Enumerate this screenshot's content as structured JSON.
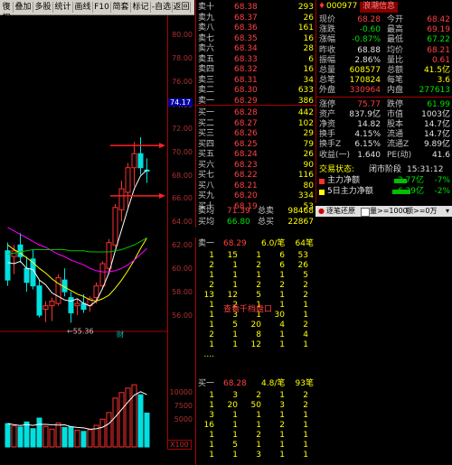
{
  "toolbar": {
    "items": [
      "復权",
      "叠加",
      "多股",
      "统计",
      "画线",
      "F10",
      "简套",
      "标记",
      "-自选",
      "返回"
    ]
  },
  "axis": {
    "ticks": [
      "80.00",
      "78.00",
      "76.00",
      "74.00",
      "72.00",
      "70.00",
      "68.00",
      "66.00",
      "64.00",
      "62.00",
      "60.00",
      "58.00",
      "56.00"
    ],
    "highlight": "74.17",
    "low_label": "55.36",
    "vol_ticks": [
      "10000",
      "7500",
      "5000"
    ],
    "unit": "X100",
    "marker": "财"
  },
  "book": {
    "asks": [
      {
        "label": "卖十",
        "price": "68.38",
        "vol": "293"
      },
      {
        "label": "卖九",
        "price": "68.37",
        "vol": "26"
      },
      {
        "label": "卖八",
        "price": "68.36",
        "vol": "161"
      },
      {
        "label": "卖七",
        "price": "68.35",
        "vol": "16"
      },
      {
        "label": "卖六",
        "price": "68.34",
        "vol": "28"
      },
      {
        "label": "卖五",
        "price": "68.33",
        "vol": "6"
      },
      {
        "label": "卖四",
        "price": "68.32",
        "vol": "16"
      },
      {
        "label": "卖三",
        "price": "68.31",
        "vol": "34"
      },
      {
        "label": "卖二",
        "price": "68.30",
        "vol": "633"
      },
      {
        "label": "卖一",
        "price": "68.29",
        "vol": "386"
      }
    ],
    "bids": [
      {
        "label": "买一",
        "price": "68.28",
        "vol": "442"
      },
      {
        "label": "买二",
        "price": "68.27",
        "vol": "102"
      },
      {
        "label": "买三",
        "price": "68.26",
        "vol": "29"
      },
      {
        "label": "买四",
        "price": "68.25",
        "vol": "79"
      },
      {
        "label": "买五",
        "price": "68.24",
        "vol": "26"
      },
      {
        "label": "买六",
        "price": "68.23",
        "vol": "90"
      },
      {
        "label": "买七",
        "price": "68.22",
        "vol": "116"
      },
      {
        "label": "买八",
        "price": "68.21",
        "vol": "80"
      },
      {
        "label": "买九",
        "price": "68.20",
        "vol": "334"
      },
      {
        "label": "买十",
        "price": "68.19",
        "vol": "53"
      }
    ],
    "ask_avg": {
      "label": "卖均",
      "price": "71.39",
      "tot_label": "总卖",
      "tot": "98468"
    },
    "bid_avg": {
      "label": "买均",
      "price": "66.80",
      "tot_label": "总买",
      "tot": "22867"
    }
  },
  "stats": {
    "code": "000977",
    "name": "浪潮信息",
    "rows": [
      [
        "现价",
        "68.28",
        "今开",
        "68.42"
      ],
      [
        "涨跌",
        "-0.60",
        "最高",
        "69.19"
      ],
      [
        "涨幅",
        "-0.87%",
        "最低",
        "67.22"
      ],
      [
        "昨收",
        "68.88",
        "均价",
        "68.21"
      ],
      [
        "振幅",
        "2.86%",
        "量比",
        "0.61"
      ],
      [
        "总量",
        "608577",
        "总额",
        "41.5亿"
      ],
      [
        "总笔",
        "170824",
        "每笔",
        "3.6"
      ],
      [
        "外盘",
        "330964",
        "内盘",
        "277613"
      ],
      [
        "涨停",
        "75.77",
        "跌停",
        "61.99"
      ],
      [
        "资产",
        "837.9亿",
        "市值",
        "1003亿"
      ],
      [
        "净资",
        "14.82",
        "股本",
        "14.7亿"
      ],
      [
        "换手",
        "4.15%",
        "流通",
        "14.7亿"
      ],
      [
        "换手Z",
        "6.15%",
        "流通Z",
        "9.89亿"
      ],
      [
        "收益(一)",
        "1.640",
        "PE(动)",
        "41.6"
      ]
    ],
    "status_label": "交易状态:",
    "status": "闭市阶段",
    "time": "15:31:12",
    "flow1_label": "主力净额",
    "flow1_val": "-2.77亿",
    "flow1_pct": "-7%",
    "flow2_label": "5日主力净额",
    "flow2_val": "-6.29亿",
    "flow2_pct": "-2%"
  },
  "tickbar": {
    "label": "逐笔还原",
    "filter": "量>=1000",
    "dir": "额>=0万"
  },
  "ticks": {
    "sell1": {
      "label": "卖一",
      "price": "68.29",
      "avg": "6.0/笔",
      "count": "64笔"
    },
    "sell_rows": [
      [
        "1",
        "15",
        "1",
        "6",
        "53"
      ],
      [
        "2",
        "1",
        "2",
        "6",
        "26"
      ],
      [
        "1",
        "1",
        "1",
        "1",
        "5"
      ],
      [
        "2",
        "1",
        "2",
        "2",
        "2"
      ],
      [
        "13",
        "12",
        "5",
        "1",
        "2"
      ],
      [
        "1",
        "2",
        "1",
        "1",
        "1"
      ],
      [
        "1",
        "3",
        "1",
        "30",
        "1"
      ],
      [
        "1",
        "5",
        "20",
        "4",
        "2"
      ],
      [
        "2",
        "1",
        "8",
        "1",
        "4"
      ],
      [
        "1",
        "1",
        "12",
        "1",
        "1"
      ],
      [
        "....",
        "",
        "",
        "",
        ""
      ]
    ],
    "collapse": "查看千档盘口",
    "buy1": {
      "label": "买一",
      "price": "68.28",
      "avg": "4.8/笔",
      "count": "93笔"
    },
    "buy_rows": [
      [
        "1",
        "3",
        "2",
        "1",
        "2"
      ],
      [
        "1",
        "20",
        "50",
        "3",
        "2"
      ],
      [
        "3",
        "1",
        "1",
        "1",
        "1"
      ],
      [
        "16",
        "1",
        "1",
        "2",
        "1"
      ],
      [
        "1",
        "1",
        "2",
        "1",
        "1"
      ],
      [
        "1",
        "5",
        "1",
        "1",
        "1"
      ],
      [
        "1",
        "1",
        "3",
        "1",
        "1"
      ]
    ]
  },
  "chart_data": {
    "type": "candlestick",
    "price_ylim": [
      55,
      81
    ],
    "candles": [
      {
        "o": 61.5,
        "h": 62.2,
        "l": 58.5,
        "c": 59.0
      },
      {
        "o": 61.0,
        "h": 62.0,
        "l": 59.5,
        "c": 61.5
      },
      {
        "o": 62.0,
        "h": 63.0,
        "l": 60.5,
        "c": 61.0
      },
      {
        "o": 60.0,
        "h": 61.0,
        "l": 58.0,
        "c": 58.8
      },
      {
        "o": 60.8,
        "h": 61.6,
        "l": 58.2,
        "c": 58.5
      },
      {
        "o": 58.5,
        "h": 59.0,
        "l": 55.8,
        "c": 56.0
      },
      {
        "o": 56.5,
        "h": 57.2,
        "l": 55.4,
        "c": 56.8
      },
      {
        "o": 56.8,
        "h": 57.5,
        "l": 55.5,
        "c": 57.2
      },
      {
        "o": 57.0,
        "h": 59.5,
        "l": 56.8,
        "c": 59.2
      },
      {
        "o": 59.0,
        "h": 60.0,
        "l": 57.6,
        "c": 58.0
      },
      {
        "o": 57.5,
        "h": 58.0,
        "l": 55.36,
        "c": 56.2
      },
      {
        "o": 56.8,
        "h": 57.4,
        "l": 56.0,
        "c": 57.0
      },
      {
        "o": 57.0,
        "h": 57.8,
        "l": 56.2,
        "c": 56.5
      },
      {
        "o": 56.8,
        "h": 57.6,
        "l": 56.3,
        "c": 57.4
      },
      {
        "o": 57.5,
        "h": 58.8,
        "l": 57.0,
        "c": 58.5
      },
      {
        "o": 58.5,
        "h": 60.6,
        "l": 58.2,
        "c": 60.4
      },
      {
        "o": 60.0,
        "h": 62.5,
        "l": 59.5,
        "c": 62.2
      },
      {
        "o": 62.0,
        "h": 65.5,
        "l": 61.8,
        "c": 65.2
      },
      {
        "o": 65.0,
        "h": 67.5,
        "l": 64.0,
        "c": 66.8
      },
      {
        "o": 66.5,
        "h": 69.0,
        "l": 65.2,
        "c": 68.6
      },
      {
        "o": 68.6,
        "h": 70.8,
        "l": 67.0,
        "c": 69.8
      },
      {
        "o": 69.8,
        "h": 71.2,
        "l": 68.0,
        "c": 68.6
      },
      {
        "o": 68.4,
        "h": 69.4,
        "l": 67.3,
        "c": 68.3
      }
    ],
    "ma5": [
      60.5,
      60.4,
      60.6,
      60.0,
      59.9,
      59.0,
      58.6,
      57.9,
      57.6,
      57.3,
      57.2,
      57.4,
      57.0,
      56.8,
      57.2,
      58.3,
      59.6,
      61.5,
      63.3,
      65.1,
      66.8,
      67.9,
      68.4
    ],
    "ma10": [
      62.0,
      61.6,
      61.3,
      60.9,
      60.5,
      60.0,
      59.6,
      59.1,
      58.7,
      58.4,
      58.1,
      57.8,
      57.6,
      57.3,
      57.2,
      57.4,
      57.7,
      58.3,
      59.0,
      59.8,
      60.7,
      61.7,
      62.6
    ],
    "ma20": [
      63.5,
      63.2,
      62.9,
      62.6,
      62.3,
      62.0,
      61.8,
      61.5,
      61.2,
      61.0,
      60.7,
      60.5,
      60.3,
      60.0,
      59.8,
      59.7,
      59.7,
      59.8,
      60.0,
      60.3,
      60.7,
      61.2,
      61.7
    ],
    "ma60": [
      61.2,
      61.3,
      61.4,
      61.5,
      61.6,
      61.6,
      61.6,
      61.6,
      61.6,
      61.6,
      61.5,
      61.5,
      61.5,
      61.4,
      61.4,
      61.4,
      61.4,
      61.5,
      61.6,
      61.8,
      62.0,
      62.3,
      62.6
    ],
    "volumes": [
      4200,
      3800,
      3600,
      4500,
      3300,
      5200,
      3700,
      3200,
      4300,
      3500,
      3600,
      3000,
      2800,
      3100,
      3900,
      5000,
      6200,
      8800,
      9800,
      10600,
      11200,
      9400,
      6100
    ],
    "vol_ylim": [
      0,
      13500
    ],
    "marks": [
      70.5,
      66.2
    ]
  }
}
